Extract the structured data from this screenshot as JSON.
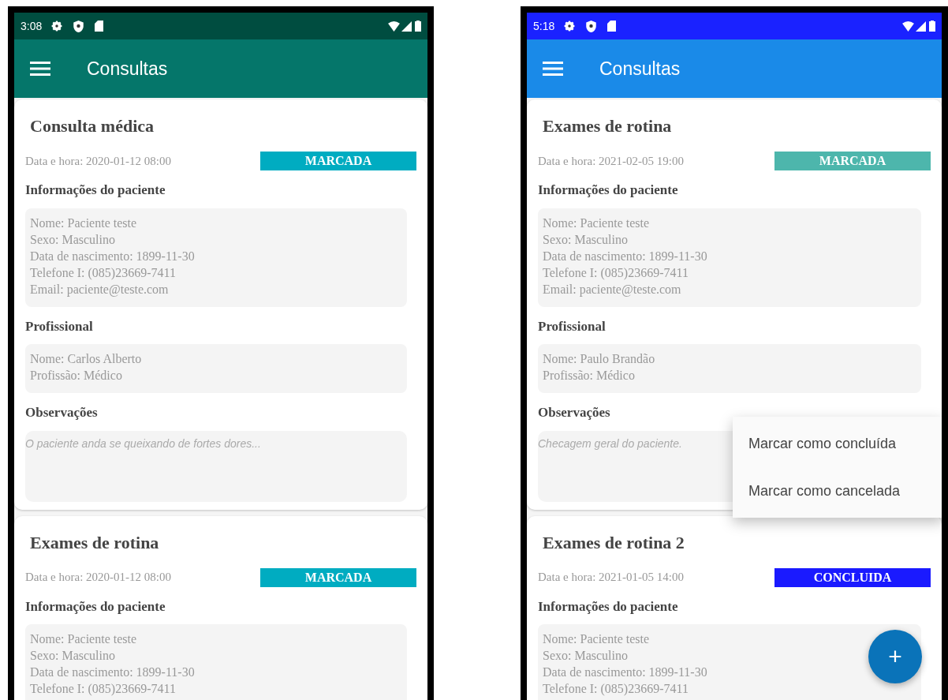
{
  "phones": [
    {
      "kind": "teal",
      "status_bar": {
        "time": "3:08"
      },
      "app_bar": {
        "title": "Consultas"
      },
      "cards": [
        {
          "title": "Consulta médica",
          "datetime": "Data e hora: 2020-01-12 08:00",
          "status": {
            "label": "MARCADA",
            "color": "#00acc1"
          },
          "sections": [
            {
              "kind": "lines",
              "heading": "Informações do paciente",
              "lines": [
                "Nome: Paciente teste",
                "Sexo: Masculino",
                "Data de nascimento: 1899-11-30",
                "Telefone I: (085)23669-7411",
                "Email: paciente@teste.com"
              ]
            },
            {
              "kind": "lines",
              "heading": "Profissional",
              "lines": [
                "Nome: Carlos Alberto",
                "Profissão: Médico"
              ]
            },
            {
              "kind": "note",
              "heading": "Observações",
              "text": "O paciente anda se queixando de fortes dores..."
            }
          ]
        },
        {
          "title": "Exames de rotina",
          "datetime": "Data e hora: 2020-01-12 08:00",
          "status": {
            "label": "MARCADA",
            "color": "#00acc1"
          },
          "sections": [
            {
              "kind": "lines",
              "heading": "Informações do paciente",
              "lines": [
                "Nome: Paciente teste",
                "Sexo: Masculino",
                "Data de nascimento: 1899-11-30",
                "Telefone I: (085)23669-7411"
              ]
            }
          ]
        }
      ]
    },
    {
      "kind": "blue",
      "status_bar": {
        "time": "5:18"
      },
      "app_bar": {
        "title": "Consultas"
      },
      "cards": [
        {
          "title": "Exames de rotina",
          "datetime": "Data e hora: 2021-02-05 19:00",
          "status": {
            "label": "MARCADA",
            "color": "#4db6ac"
          },
          "sections": [
            {
              "kind": "lines",
              "heading": "Informações do paciente",
              "lines": [
                "Nome: Paciente teste",
                "Sexo: Masculino",
                "Data de nascimento: 1899-11-30",
                "Telefone I: (085)23669-7411",
                "Email: paciente@teste.com"
              ]
            },
            {
              "kind": "lines",
              "heading": "Profissional",
              "lines": [
                "Nome: Paulo Brandão",
                "Profissão: Médico"
              ]
            },
            {
              "kind": "note",
              "heading": "Observações",
              "text": "Checagem geral do paciente."
            }
          ]
        },
        {
          "title": "Exames de rotina 2",
          "datetime": "Data e hora: 2021-01-05 14:00",
          "status": {
            "label": "CONCLUIDA",
            "color": "#1a1aff"
          },
          "sections": [
            {
              "kind": "lines",
              "heading": "Informações do paciente",
              "lines": [
                "Nome: Paciente teste",
                "Sexo: Masculino",
                "Data de nascimento: 1899-11-30",
                "Telefone I: (085)23669-7411"
              ]
            }
          ]
        }
      ],
      "menu": {
        "items": [
          "Marcar como concluída",
          "Marcar como cancelada"
        ]
      },
      "fab": {
        "label": "+"
      }
    }
  ]
}
